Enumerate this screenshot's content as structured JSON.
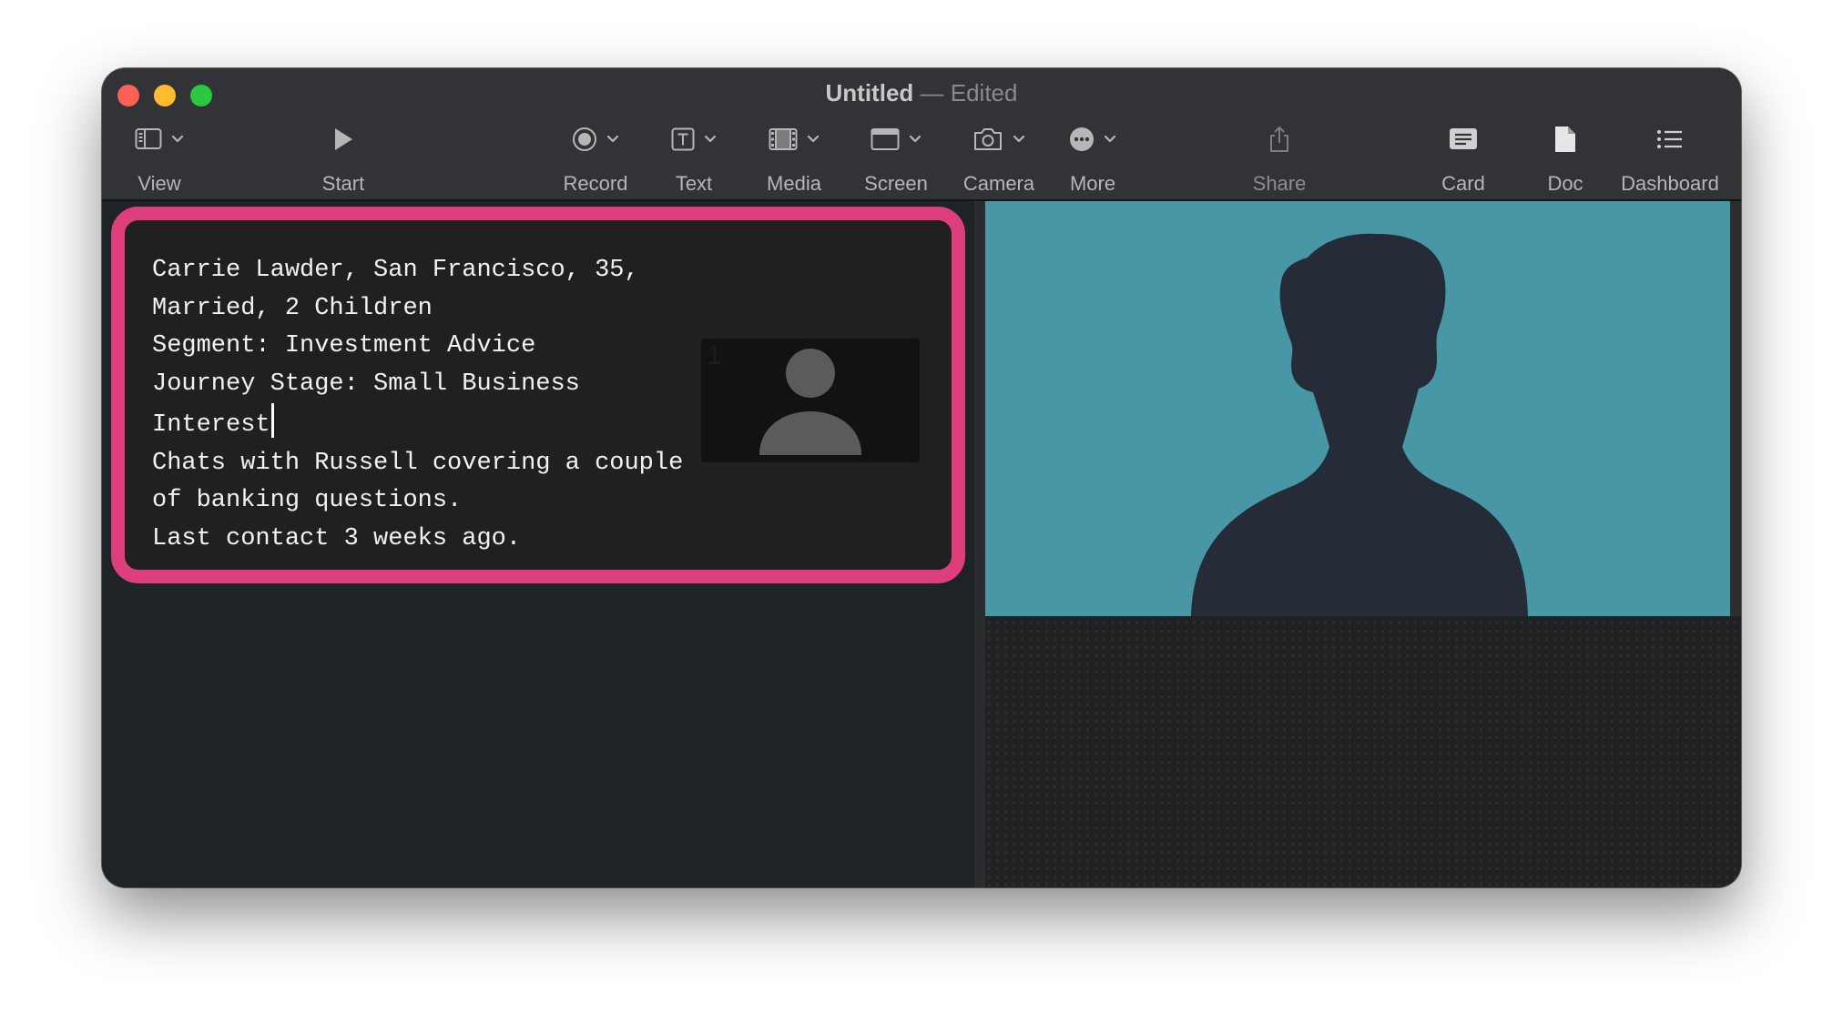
{
  "window": {
    "title": "Untitled",
    "separator": "—",
    "status": "Edited"
  },
  "toolbar": {
    "view": "View",
    "start": "Start",
    "record": "Record",
    "text": "Text",
    "media": "Media",
    "screen": "Screen",
    "camera": "Camera",
    "more": "More",
    "share": "Share",
    "card": "Card",
    "doc": "Doc",
    "dashboard": "Dashboard"
  },
  "card": {
    "lines": [
      "Carrie Lawder, San Francisco, 35,",
      "Married, 2 Children",
      "Segment: Investment Advice",
      "Journey Stage: Small Business",
      "Interest",
      "Chats with Russell covering a couple",
      "of banking questions.",
      "Last contact 3 weeks ago."
    ],
    "thumbnail_badge": "1"
  },
  "colors": {
    "card_border": "#df3e7d",
    "camera_background": "#4797a7",
    "silhouette": "#252c38"
  },
  "icons": {
    "view": "sidebar-icon",
    "start": "play-icon",
    "record": "record-icon",
    "text": "text-box-icon",
    "media": "film-icon",
    "screen": "window-icon",
    "camera": "camera-icon",
    "more": "ellipsis-circle-icon",
    "share": "share-icon",
    "card": "card-icon",
    "doc": "document-icon",
    "dashboard": "list-icon"
  }
}
